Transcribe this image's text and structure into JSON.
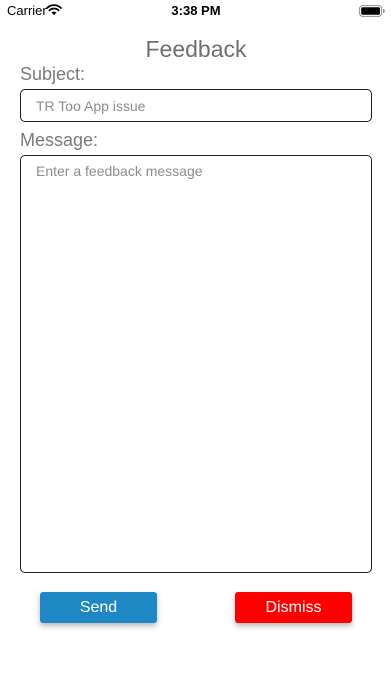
{
  "status_bar": {
    "carrier": "Carrier",
    "time": "3:38 PM",
    "wifi_icon": "wifi-icon",
    "battery_icon": "battery-icon"
  },
  "page": {
    "title": "Feedback"
  },
  "form": {
    "subject_label": "Subject:",
    "subject_placeholder": "TR Too App issue",
    "message_label": "Message:",
    "message_placeholder": "Enter a feedback message"
  },
  "actions": {
    "send_label": "Send",
    "dismiss_label": "Dismiss"
  },
  "colors": {
    "send_button": "#1d88c4",
    "dismiss_button": "#ff0000",
    "title_text": "#6f6f6f",
    "label_text": "#7a7a7a"
  }
}
